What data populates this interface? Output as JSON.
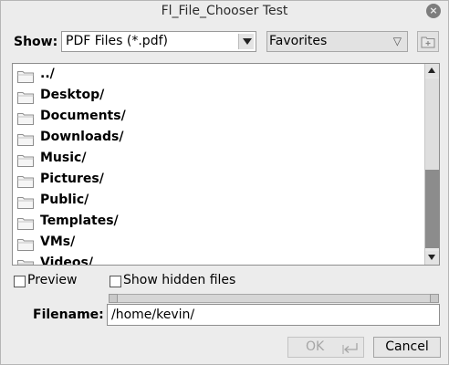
{
  "window": {
    "title": "Fl_File_Chooser Test",
    "close_glyph": "×"
  },
  "show": {
    "label": "Show:",
    "filter_value": "PDF Files (*.pdf)",
    "favorites_value": "Favorites",
    "favorites_arrow": "▽"
  },
  "files": [
    {
      "name": "../"
    },
    {
      "name": "Desktop/"
    },
    {
      "name": "Documents/"
    },
    {
      "name": "Downloads/"
    },
    {
      "name": "Music/"
    },
    {
      "name": "Pictures/"
    },
    {
      "name": "Public/"
    },
    {
      "name": "Templates/"
    },
    {
      "name": "VMs/"
    },
    {
      "name": "Videos/"
    }
  ],
  "options": {
    "preview_label": "Preview",
    "hidden_label": "Show hidden files"
  },
  "filename": {
    "label": "Filename:",
    "value": "/home/kevin/"
  },
  "buttons": {
    "ok_label": "OK",
    "cancel_label": "Cancel"
  },
  "icons": {
    "folder": "folder-icon",
    "new_folder": "new-folder-icon",
    "enter": "enter-icon"
  },
  "colors": {
    "folder_fill": "#f5f5f5",
    "thumb": "#8c8c8c",
    "window_bg": "#ececec"
  }
}
